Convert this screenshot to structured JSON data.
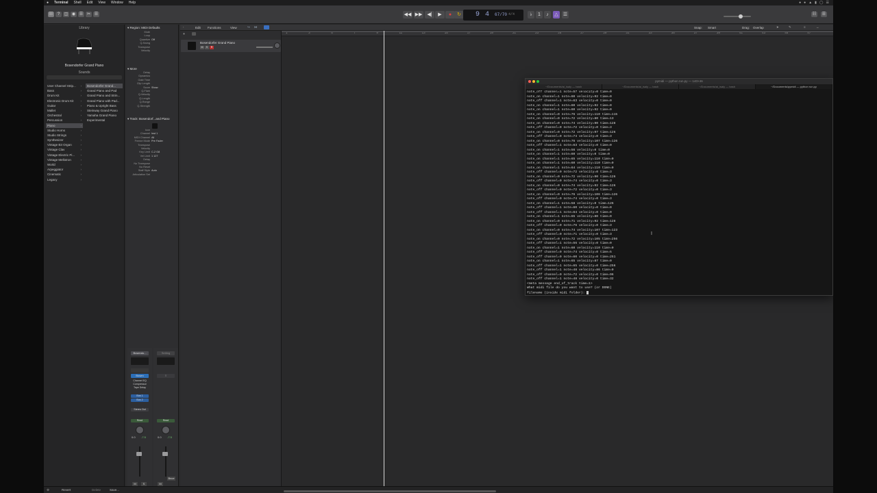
{
  "menubar": {
    "apple": "",
    "items": [
      "Terminal",
      "Shell",
      "Edit",
      "View",
      "Window",
      "Help"
    ]
  },
  "controlbar": {
    "lcd_bar": "9 4",
    "lcd_tempo": "67/70",
    "lcd_sig": "4/4"
  },
  "library": {
    "title": "Library",
    "patch_name": "Bosendorfer Grand Piano",
    "sounds_label": "Sounds",
    "categories": [
      "User Channel Strip...",
      "Bass",
      "Drum Kit",
      "Electronic Drum Kit",
      "Guitar",
      "Mallet",
      "Orchestral",
      "Percussion",
      "Piano",
      "Studio Horns",
      "Studio Strings",
      "Synthesizer",
      "Vintage B3 Organ",
      "Vintage Clav",
      "Vintage Electric Pi...",
      "Vintage Mellotron",
      "World",
      "Arpeggiator",
      "Cinematic",
      "Legacy"
    ],
    "patches": [
      "Bosendorfer Grand...",
      "Grand Piano and Pad",
      "Grand Piano and Strin...",
      "Grand Piano with Pad...",
      "Piano & Upright Bass",
      "Steinway Grand Piano",
      "Yamaha Grand Piano",
      "Experimental"
    ],
    "selected_category": "Piano",
    "selected_patch": "Bosendorfer Grand..."
  },
  "inspector": {
    "region_header": "Region: MIDI Defaults",
    "region_rows": [
      {
        "label": "Mute",
        "value": ""
      },
      {
        "label": "Loop",
        "value": ""
      },
      {
        "label": "Quantize",
        "value": "Off"
      },
      {
        "label": "Q-Swing",
        "value": ""
      },
      {
        "label": "Transpose",
        "value": ""
      },
      {
        "label": "Velocity",
        "value": ""
      }
    ],
    "more_header": "More",
    "more_rows": [
      {
        "label": "Delay",
        "value": ""
      },
      {
        "label": "Dynamics",
        "value": ""
      },
      {
        "label": "Gate Time",
        "value": ""
      },
      {
        "label": "Clip Length",
        "value": ""
      },
      {
        "label": "Score",
        "value": "Show"
      },
      {
        "label": "Q-Flam",
        "value": ""
      },
      {
        "label": "Q-Velocity",
        "value": ""
      },
      {
        "label": "Q-Length",
        "value": ""
      },
      {
        "label": "Q-Range",
        "value": ""
      },
      {
        "label": "Q-Strength",
        "value": ""
      }
    ],
    "track_header": "Track: Bosendorf...and Piano",
    "track_rows": [
      {
        "label": "Icon",
        "value": ""
      },
      {
        "label": "Channel",
        "value": "Inst 1"
      },
      {
        "label": "MIDI Channel",
        "value": "All"
      },
      {
        "label": "Freeze Mode",
        "value": "Pre Fader"
      },
      {
        "label": "Transpose",
        "value": ""
      },
      {
        "label": "Velocity",
        "value": ""
      },
      {
        "label": "Key Limit",
        "value": "C-2 G8"
      },
      {
        "label": "Vel Limit",
        "value": "1 127"
      },
      {
        "label": "Delay",
        "value": ""
      },
      {
        "label": "No Transpose",
        "value": ""
      },
      {
        "label": "No Reset",
        "value": ""
      },
      {
        "label": "Staff Style",
        "value": "Auto"
      },
      {
        "label": "Articulation Set",
        "value": ""
      }
    ]
  },
  "strips": {
    "left": {
      "setting": "Bosendo...",
      "eq": "",
      "midi_fx": "",
      "instrument": "Bosen",
      "fx": [
        "Channel EQ",
        "Compressor",
        "Tape Delay"
      ],
      "sends": [
        "Bus 1",
        "Bus 2"
      ],
      "output": "Stereo Out",
      "group": "Read",
      "pan": "",
      "vol": "0.0",
      "peak": "-7.5",
      "mute": "M",
      "solo": "S",
      "name": "Bosend...nd Piano"
    },
    "right": {
      "setting": "Setting",
      "eq": "",
      "output": "",
      "group": "Read",
      "vol": "0.0",
      "peak": "-7.5",
      "mute": "M",
      "bnce": "Bnce",
      "name": "Stereo Out"
    }
  },
  "tracks": {
    "toolbar_items": [
      "Edit",
      "Functions",
      "View"
    ],
    "snap_label": "Snap:",
    "snap_value": "Smart",
    "drag_label": "Drag:",
    "drag_value": "Overlap",
    "track_name": "Bosendorfer Grand Piano",
    "ruler_ticks": [
      "1",
      "3",
      "5",
      "7",
      "9",
      "11",
      "13",
      "15",
      "17",
      "19",
      "21",
      "23",
      "25",
      "27",
      "29",
      "31",
      "33",
      "35",
      "37",
      "39",
      "41",
      "43",
      "45",
      "47"
    ]
  },
  "terminal": {
    "title": "pymidi — python run.py — 140×46",
    "tabs": [
      "~/Documents/ai_isaly — bash",
      "~/Documents/ai_isaly — bash",
      "~/Documents/ai_isaly — bash",
      "~/Documents/pymidi — python run.py"
    ],
    "lines": [
      "note_off channel=1 note=57 velocity=0 time=0",
      "note_on channel=1 note=60 velocity=92 time=0",
      "note_off channel=1 note=63 velocity=0 time=0",
      "note_on channel=1 note=60 velocity=92 time=0",
      "note_on channel=1 note=60 velocity=92 time=0",
      "note_on channel=0 note=76 velocity=110 time=115",
      "note_on channel=0 note=72 velocity=80 time=13",
      "note_on channel=0 note=74 velocity=90 time=128",
      "note_off channel=0 note=72 velocity=0 time=3",
      "note_on channel=0 note=72 velocity=97 time=126",
      "note_off channel=0 note=74 velocity=0 time=3",
      "note_on channel=0 note=76 velocity=107 time=126",
      "note_off channel=1 note=63 velocity=0 time=0",
      "note_on channel=1 note=56 velocity=0 time=0",
      "note_on channel=1 note=60 velocity=0 time=0",
      "note_on channel=1 note=65 velocity=110 time=0",
      "note_on channel=1 note=60 velocity=110 time=0",
      "note_on channel=1 note=64 velocity=110 time=0",
      "note_off channel=0 note=72 velocity=0 time=3",
      "note_on channel=0 note=72 velocity=90 time=126",
      "note_off channel=0 note=74 velocity=0 time=3",
      "note_on channel=0 note=74 velocity=92 time=126",
      "note_off channel=0 note=72 velocity=0 time=3",
      "note_on channel=0 note=76 velocity=106 time=126",
      "note_off channel=0 note=74 velocity=0 time=3",
      "note_on channel=1 note=58 velocity=0 time=126",
      "note_off channel=1 note=60 velocity=0 time=0",
      "note_off channel=1 note=64 velocity=0 time=0",
      "note_on channel=1 note=65 velocity=80 time=0",
      "note_on channel=0 note=71 velocity=92 time=128",
      "note_off channel=0 note=76 velocity=0 time=3",
      "note_on channel=0 note=74 velocity=107 time=123",
      "note_off channel=0 note=71 velocity=0 time=3",
      "note_on channel=0 note=72 velocity=105 time=256",
      "note_off channel=1 note=56 velocity=0 time=0",
      "note_on channel=1 note=60 velocity=110 time=0",
      "note_off channel=0 note=74 velocity=0 time=5",
      "note_off channel=0 note=60 velocity=0 time=251",
      "note_on channel=1 note=65 velocity=87 time=0",
      "note_off channel=1 note=65 velocity=0 time=256",
      "note_off channel=1 note=48 velocity=86 time=0",
      "note_off channel=0 note=72 velocity=0 time=96",
      "note_off channel=1 note=48 velocity=0 time=32",
      "<meta message end_of_track time=1>",
      "What midi file do you want to use? (or DONE)",
      "filename (inside midi folder): "
    ]
  },
  "bottombar": {
    "revert": "Revert",
    "delete": "Delete",
    "save": "Save..."
  }
}
